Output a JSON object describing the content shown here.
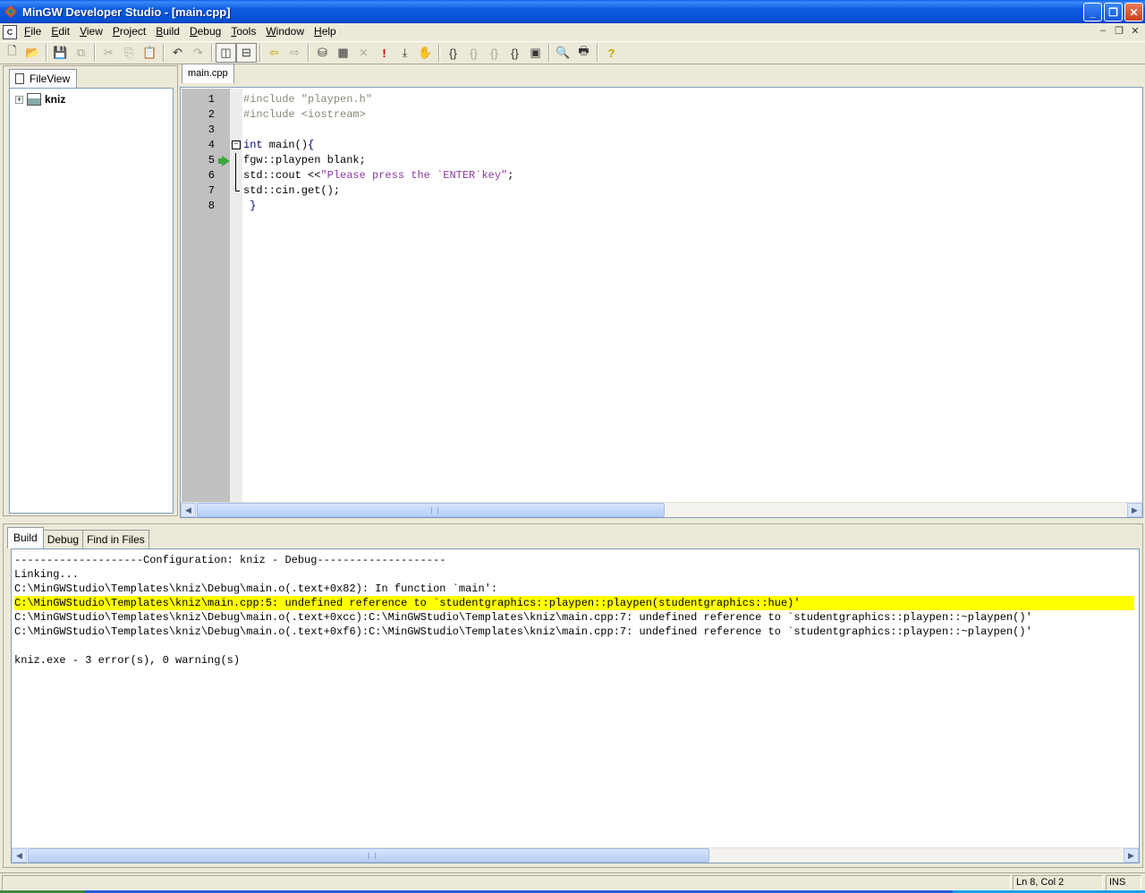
{
  "window": {
    "title": "MinGW Developer Studio - [main.cpp]",
    "buttons": {
      "minimize": "_",
      "maximize": "❐",
      "close": "✕"
    }
  },
  "menubar": {
    "items": [
      {
        "label": "File",
        "u": "F",
        "rest": "ile"
      },
      {
        "label": "Edit",
        "u": "E",
        "rest": "dit"
      },
      {
        "label": "View",
        "u": "V",
        "rest": "iew"
      },
      {
        "label": "Project",
        "u": "P",
        "rest": "roject"
      },
      {
        "label": "Build",
        "u": "B",
        "rest": "uild"
      },
      {
        "label": "Debug",
        "u": "D",
        "rest": "ebug"
      },
      {
        "label": "Tools",
        "u": "T",
        "rest": "ools"
      },
      {
        "label": "Window",
        "u": "W",
        "rest": "indow"
      },
      {
        "label": "Help",
        "u": "H",
        "rest": "elp"
      }
    ]
  },
  "fileview": {
    "tab_label": "FileView",
    "tree": {
      "expander": "+",
      "project": "kniz"
    }
  },
  "editor": {
    "tab_label": "main.cpp",
    "lines": [
      {
        "n": "1",
        "parts": [
          {
            "t": "#include \"playpen.h\"",
            "c": "pp"
          }
        ]
      },
      {
        "n": "2",
        "parts": [
          {
            "t": "#include <iostream>",
            "c": "pp"
          }
        ]
      },
      {
        "n": "3",
        "parts": []
      },
      {
        "n": "4",
        "parts": [
          {
            "t": "int",
            "c": "kw"
          },
          {
            "t": " main()",
            "c": "pl"
          },
          {
            "t": "{",
            "c": "kw"
          }
        ]
      },
      {
        "n": "5",
        "parts": [
          {
            "t": "fgw::playpen blank;",
            "c": "pl"
          }
        ]
      },
      {
        "n": "6",
        "parts": [
          {
            "t": "std::cout <<",
            "c": "pl"
          },
          {
            "t": "\"Please press the `ENTER`key\"",
            "c": "str"
          },
          {
            "t": ";",
            "c": "pl"
          }
        ]
      },
      {
        "n": "7",
        "parts": [
          {
            "t": "std::cin.get();",
            "c": "pl"
          }
        ]
      },
      {
        "n": "8",
        "parts": [
          {
            "t": " }",
            "c": "kw"
          }
        ]
      }
    ]
  },
  "output": {
    "tabs": [
      "Build",
      "Debug",
      "Find in Files"
    ],
    "lines": [
      "--------------------Configuration: kniz - Debug--------------------",
      "Linking...",
      "C:\\MinGWStudio\\Templates\\kniz\\Debug\\main.o(.text+0x82): In function `main':",
      "C:\\MinGWStudio\\Templates\\kniz\\main.cpp:5: undefined reference to `studentgraphics::playpen::playpen(studentgraphics::hue)'",
      "C:\\MinGWStudio\\Templates\\kniz\\Debug\\main.o(.text+0xcc):C:\\MinGWStudio\\Templates\\kniz\\main.cpp:7: undefined reference to `studentgraphics::playpen::~playpen()'",
      "C:\\MinGWStudio\\Templates\\kniz\\Debug\\main.o(.text+0xf6):C:\\MinGWStudio\\Templates\\kniz\\main.cpp:7: undefined reference to `studentgraphics::playpen::~playpen()'",
      "",
      "kniz.exe - 3 error(s), 0 warning(s)"
    ],
    "highlighted_line": 3,
    "highlight_color": "#ffff00"
  },
  "statusbar": {
    "position": "Ln 8, Col 2",
    "mode": "INS"
  }
}
